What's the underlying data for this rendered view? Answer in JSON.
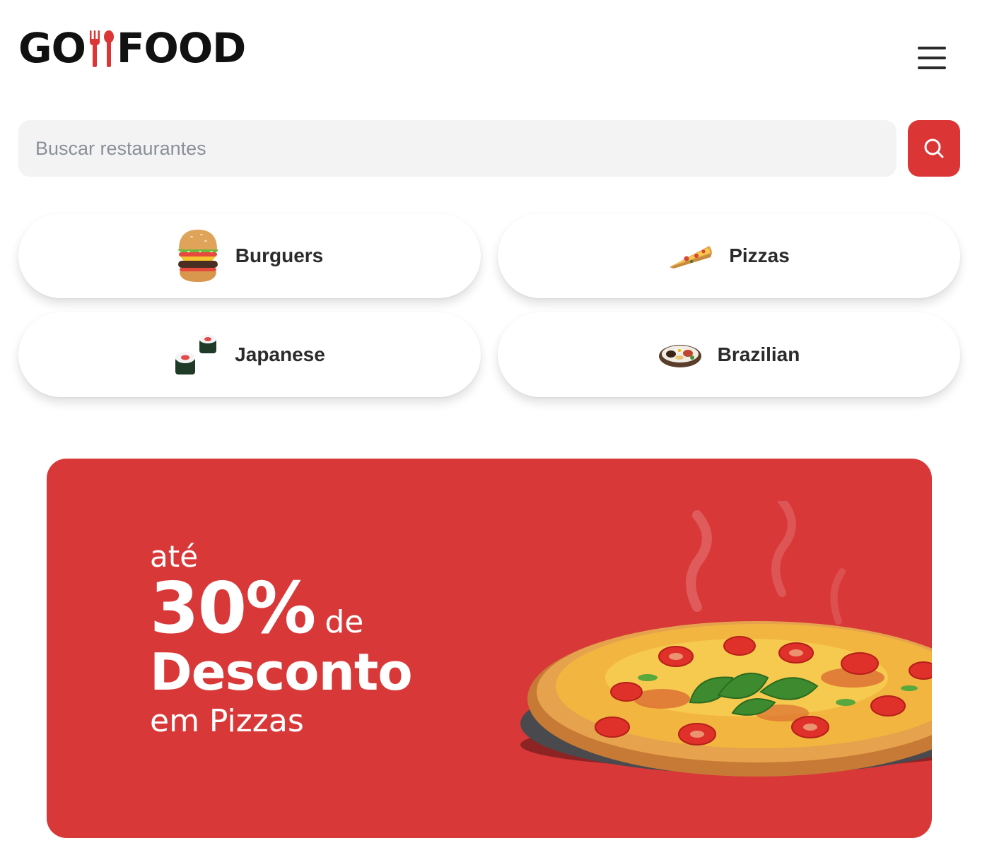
{
  "header": {
    "logo_left": "GO",
    "logo_right": "FOOD",
    "menu_icon": "hamburger-menu-icon"
  },
  "search": {
    "placeholder": "Buscar restaurantes",
    "icon": "search-icon"
  },
  "categories": [
    {
      "label": "Burguers",
      "icon": "burger-icon"
    },
    {
      "label": "Pizzas",
      "icon": "pizza-slice-icon"
    },
    {
      "label": "Japanese",
      "icon": "sushi-icon"
    },
    {
      "label": "Brazilian",
      "icon": "brazilian-plate-icon"
    }
  ],
  "banner": {
    "line1": "até",
    "percent": "30%",
    "de": "de",
    "line3": "Desconto",
    "line4": "em Pizzas"
  },
  "colors": {
    "accent": "#dc3535",
    "banner_bg": "#d93838",
    "search_bg": "#f3f3f4"
  }
}
